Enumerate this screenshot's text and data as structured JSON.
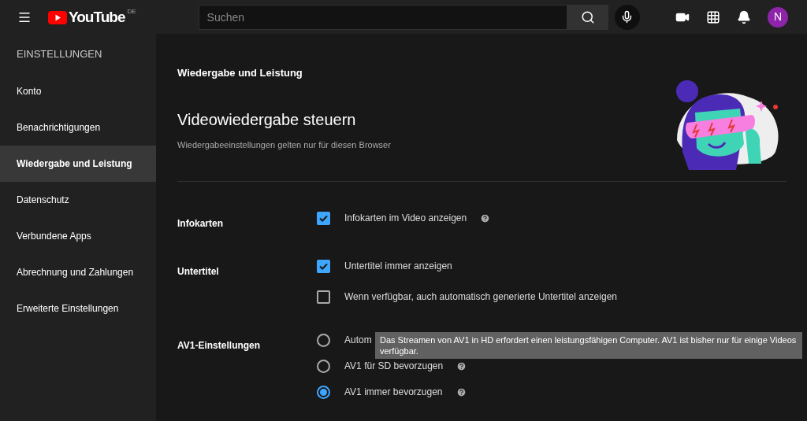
{
  "header": {
    "logo_text": "YouTube",
    "region": "DE",
    "search": {
      "placeholder": "Suchen"
    },
    "avatar": "N"
  },
  "sidebar": {
    "title": "EINSTELLUNGEN",
    "items": [
      {
        "label": "Konto",
        "selected": false
      },
      {
        "label": "Benachrichtigungen",
        "selected": false
      },
      {
        "label": "Wiedergabe und Leistung",
        "selected": true
      },
      {
        "label": "Datenschutz",
        "selected": false
      },
      {
        "label": "Verbundene Apps",
        "selected": false
      },
      {
        "label": "Abrechnung und Zahlungen",
        "selected": false
      },
      {
        "label": "Erweiterte Einstellungen",
        "selected": false
      }
    ]
  },
  "page": {
    "heading": "Wiedergabe und Leistung",
    "title": "Videowiedergabe steuern",
    "subtitle": "Wiedergabeeinstellungen gelten nur für diesen Browser"
  },
  "sections": [
    {
      "label": "Infokarten",
      "options": [
        {
          "kind": "checkbox",
          "label": "Infokarten im Video anzeigen",
          "checked": true,
          "help": true
        }
      ]
    },
    {
      "label": "Untertitel",
      "options": [
        {
          "kind": "checkbox",
          "label": "Untertitel immer anzeigen",
          "checked": true,
          "help": false
        },
        {
          "kind": "checkbox",
          "label": "Wenn verfügbar, auch automatisch generierte Untertitel anzeigen",
          "checked": false,
          "help": false
        }
      ]
    },
    {
      "label": "AV1-Einstellungen",
      "options": [
        {
          "kind": "radio",
          "label": "Autom",
          "selected": false,
          "help": false
        },
        {
          "kind": "radio",
          "label": "AV1 für SD bevorzugen",
          "selected": false,
          "help": true
        },
        {
          "kind": "radio",
          "label": "AV1 immer bevorzugen",
          "selected": true,
          "help": true
        }
      ]
    }
  ],
  "tooltip": {
    "text": "Das Streamen von AV1 in HD erfordert einen leistungsfähigen Computer. AV1 ist bisher nur für einige Videos verfügbar."
  }
}
